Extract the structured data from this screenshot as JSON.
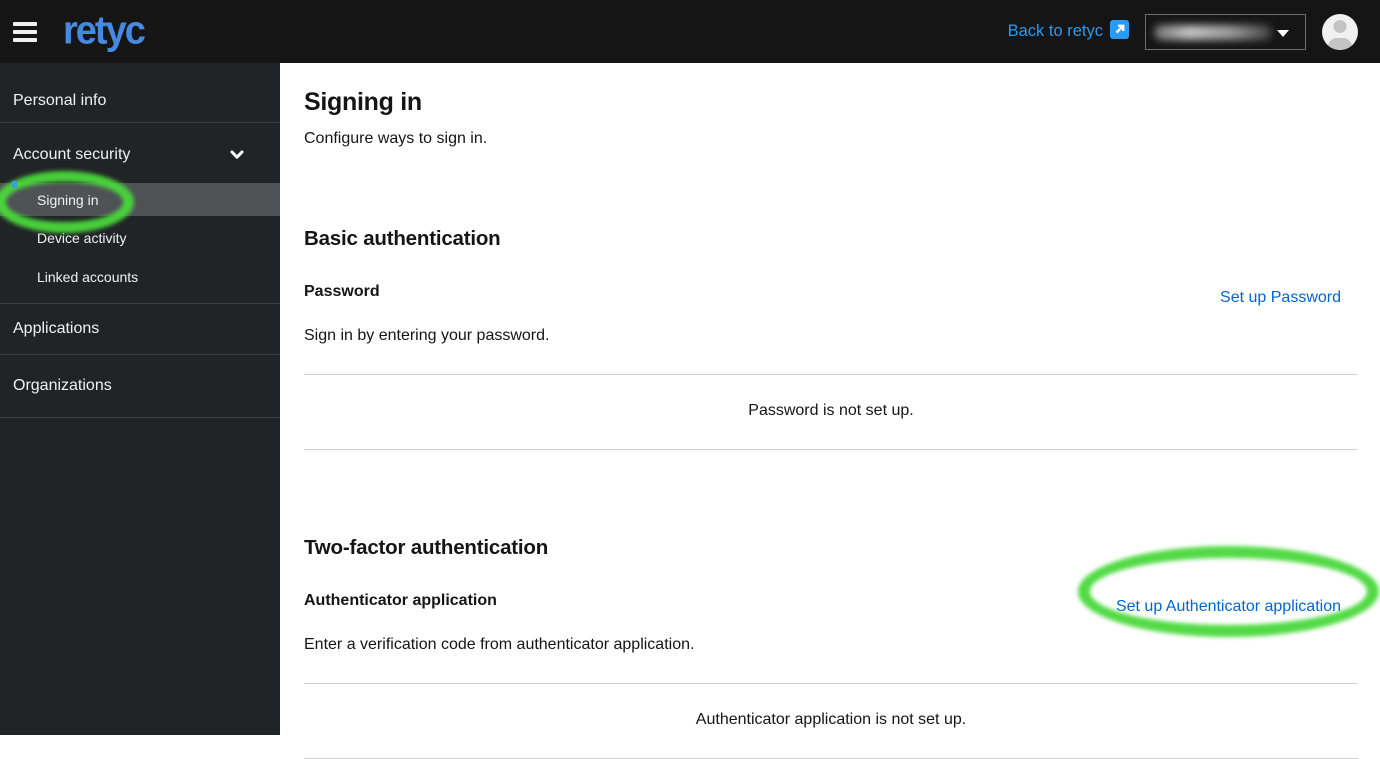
{
  "masthead": {
    "logo": "retyc",
    "back_link_label": "Back to retyc",
    "user_menu": {
      "redacted": true
    }
  },
  "sidebar": {
    "items": [
      {
        "label": "Personal info"
      },
      {
        "label": "Account security",
        "expanded": true,
        "children": [
          {
            "label": "Signing in",
            "active": true
          },
          {
            "label": "Device activity"
          },
          {
            "label": "Linked accounts"
          }
        ]
      },
      {
        "label": "Applications"
      },
      {
        "label": "Organizations"
      }
    ]
  },
  "page": {
    "title": "Signing in",
    "subtitle": "Configure ways to sign in.",
    "sections": [
      {
        "heading": "Basic authentication",
        "rows": [
          {
            "label": "Password",
            "action_label": "Set up Password",
            "description": "Sign in by entering your password.",
            "status": "Password is not set up."
          }
        ]
      },
      {
        "heading": "Two-factor authentication",
        "rows": [
          {
            "label": "Authenticator application",
            "action_label": "Set up Authenticator application",
            "description": "Enter a verification code from authenticator application.",
            "status": "Authenticator application is not set up."
          }
        ]
      }
    ]
  },
  "icons": {
    "menu": "hamburger-icon",
    "external_link": "external-link-icon",
    "section_chevron": "chevron-down-icon",
    "dropdown_caret": "caret-down-icon",
    "avatar": "user-avatar-icon"
  },
  "colors": {
    "masthead_bg": "#151515",
    "sidebar_bg": "#212427",
    "active_nav_bg": "#4f5255",
    "logo_blue": "#4589e0",
    "masthead_link_blue": "#2b9af3",
    "content_link_blue": "#0066cc",
    "annotation_green": "#4ad83c"
  },
  "annotations": {
    "type": "hand-drawn green ellipses",
    "circled": [
      "Signing in (sidebar item)",
      "Set up Authenticator application (link)"
    ]
  }
}
